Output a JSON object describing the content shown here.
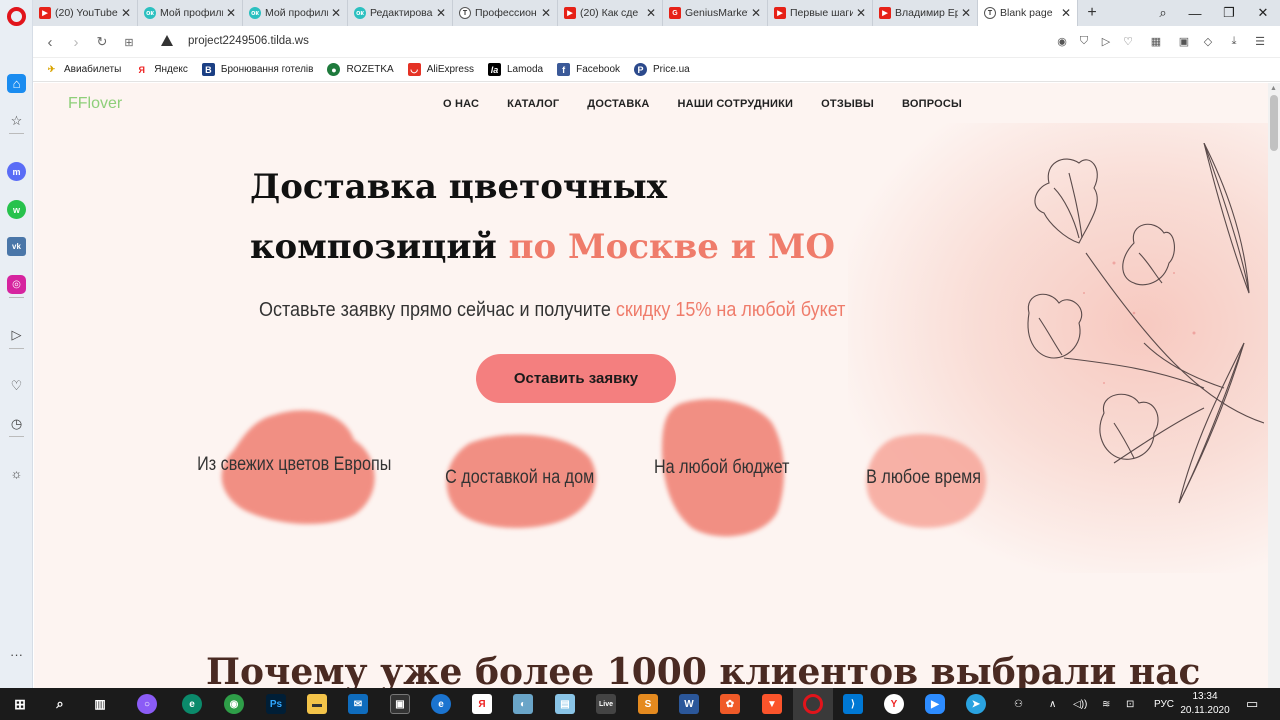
{
  "browser": {
    "tabs": [
      {
        "label": "(20) YouTube",
        "icon": "youtube-icon"
      },
      {
        "label": "Мой профиль",
        "icon": "ok-icon"
      },
      {
        "label": "Мой профиль",
        "icon": "ok-icon"
      },
      {
        "label": "Редактирова",
        "icon": "ok-icon"
      },
      {
        "label": "Профессион",
        "icon": "tilda-icon"
      },
      {
        "label": "(20) Как сде",
        "icon": "youtube-icon"
      },
      {
        "label": "GeniusMarket",
        "icon": "genius-icon"
      },
      {
        "label": "Первые шаги",
        "icon": "youtube-icon"
      },
      {
        "label": "Владимир Ер",
        "icon": "youtube-icon"
      },
      {
        "label": "Blank page",
        "icon": "tilda-icon"
      }
    ],
    "url": "project2249506.tilda.ws",
    "bookmarks": [
      {
        "label": "Авиабилеты",
        "icon": "plane-icon"
      },
      {
        "label": "Яндекс",
        "icon": "yandex-icon"
      },
      {
        "label": "Бронювання готелів",
        "icon": "booking-icon"
      },
      {
        "label": "ROZETKA",
        "icon": "rozetka-icon"
      },
      {
        "label": "AliExpress",
        "icon": "aliexpress-icon"
      },
      {
        "label": "Lamoda",
        "icon": "lamoda-icon"
      },
      {
        "label": "Facebook",
        "icon": "facebook-icon"
      },
      {
        "label": "Price.ua",
        "icon": "priceua-icon"
      }
    ]
  },
  "site": {
    "logo": "FFlover",
    "menu": [
      "О НАС",
      "КАТАЛОГ",
      "ДОСТАВКА",
      "НАШИ СОТРУДНИКИ",
      "ОТЗЫВЫ",
      "ВОПРОСЫ"
    ],
    "hero": {
      "title_line1": "Доставка цветочных",
      "title_line2_plain": "композиций ",
      "title_line2_accent": "по Москве и МО",
      "subtitle_plain": "Оставьте заявку прямо сейчас и получите ",
      "subtitle_accent": "скидку 15% на любой букет",
      "cta": "Оставить заявку"
    },
    "features": [
      "Из свежих цветов Европы",
      "С доставкой на дом",
      "На любой бюджет",
      "В любое время"
    ],
    "section2_title": "Почему уже более 1000 клиентов выбрали нас"
  },
  "taskbar": {
    "lang": "РУС",
    "time": "13:34",
    "date": "20.11.2020"
  },
  "colors": {
    "accent": "#ef7c6b",
    "cta": "#f47f7f",
    "logo": "#8ecf7a",
    "page_bg": "#fdf4f1"
  }
}
